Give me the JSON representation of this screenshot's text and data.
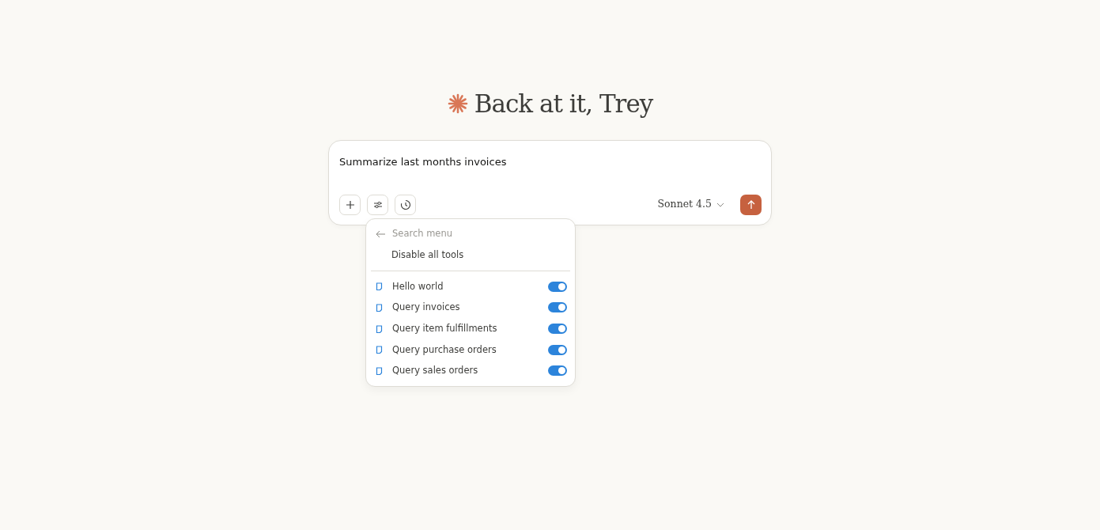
{
  "greeting": "Back at it, Trey",
  "composer": {
    "value": "Summarize last months invoices",
    "model": "Sonnet 4.5"
  },
  "menu": {
    "search_placeholder": "Search menu",
    "disable_all": "Disable all tools",
    "tools": [
      {
        "label": "Hello world",
        "on": true
      },
      {
        "label": "Query invoices",
        "on": true
      },
      {
        "label": "Query item fulfillments",
        "on": true
      },
      {
        "label": "Query purchase orders",
        "on": true
      },
      {
        "label": "Query sales orders",
        "on": true
      }
    ]
  }
}
